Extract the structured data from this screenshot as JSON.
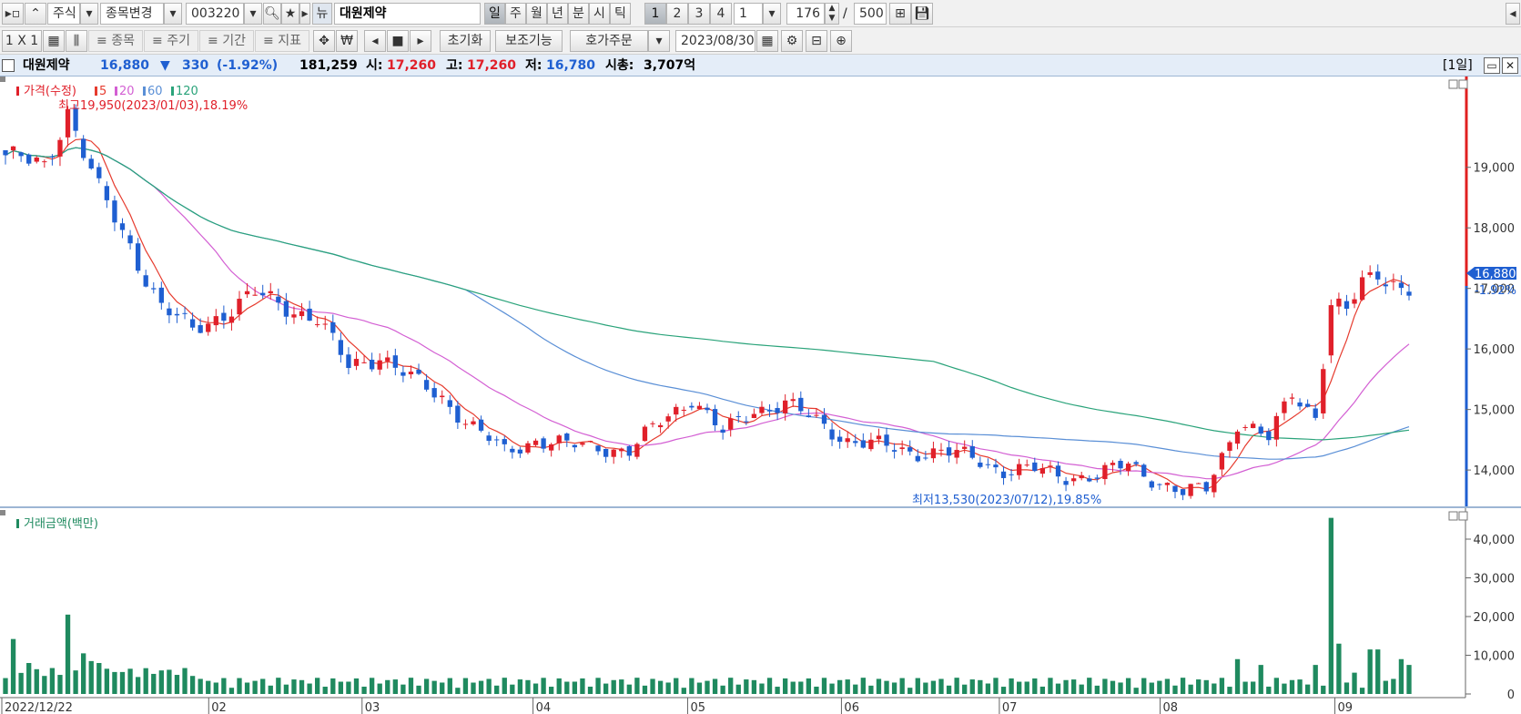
{
  "toolbar1": {
    "market": "주식",
    "change_stock": "종목변경",
    "code": "003220",
    "news_icon_label": "뉴",
    "stock_name": "대원제약",
    "periods": [
      "일",
      "주",
      "월",
      "년",
      "분",
      "시",
      "틱"
    ],
    "active_period": "일",
    "multipliers": [
      "1",
      "2",
      "3",
      "4"
    ],
    "multiplier_value": "1",
    "count": "176",
    "count_sep": "/",
    "total": "500"
  },
  "toolbar2": {
    "layout": "1 X 1",
    "stock_btn": "≡ 종목",
    "period_btn": "≡ 주기",
    "range_btn": "≡ 기간",
    "indicator_btn": "≡ 지표",
    "reset": "초기화",
    "aux": "보조기능",
    "order": "호가주문",
    "date": "2023/08/30"
  },
  "info": {
    "name": "대원제약",
    "price": "16,880",
    "change_arrow": "▼",
    "change": "330",
    "change_pct": "(-1.92%)",
    "volume": "181,259",
    "open_label": "시:",
    "open": "17,260",
    "high_label": "고:",
    "high": "17,260",
    "low_label": "저:",
    "low": "16,780",
    "mcap_label": "시총:",
    "mcap": "3,707억",
    "period_label": "[1일]"
  },
  "colors": {
    "up": "#e0202a",
    "down": "#1f5fd1",
    "ma5": "#e63b2e",
    "ma20": "#d35fd3",
    "ma60": "#5a8fd6",
    "ma120": "#2aa37a",
    "volume": "#1f8a5f"
  },
  "chart_data": {
    "type": "candlestick",
    "price_legend": {
      "main": "가격(수정)",
      "ma": [
        {
          "name": "5",
          "color": "#e63b2e"
        },
        {
          "name": "20",
          "color": "#d35fd3"
        },
        {
          "name": "60",
          "color": "#5a8fd6"
        },
        {
          "name": "120",
          "color": "#2aa37a"
        }
      ]
    },
    "annotations": {
      "high": "최고19,950(2023/01/03),18.19%",
      "low": "최저13,530(2023/07/12),19.85%"
    },
    "current_price_label": "16,880",
    "current_change_label": "-1.92%",
    "price_ylim": [
      13400,
      20500
    ],
    "price_ticks": [
      "19,000",
      "18,000",
      "17,000",
      "16,000",
      "15,000",
      "14,000"
    ],
    "price_tick_values": [
      19000,
      18000,
      17000,
      16000,
      15000,
      14000
    ],
    "volume_legend": "거래금액(백만)",
    "volume_ylim": [
      0,
      48000
    ],
    "volume_ticks": [
      "40,000",
      "30,000",
      "20,000",
      "10,000",
      "0"
    ],
    "volume_tick_values": [
      40000,
      30000,
      20000,
      10000,
      0
    ],
    "x_ticks": [
      "2022/12/22",
      "02",
      "03",
      "04",
      "05",
      "06",
      "07",
      "08",
      "09"
    ],
    "price_anchors": [
      [
        0,
        19200
      ],
      [
        5,
        19000
      ],
      [
        8,
        19950
      ],
      [
        12,
        18600
      ],
      [
        16,
        17700
      ],
      [
        20,
        16700
      ],
      [
        24,
        16300
      ],
      [
        28,
        16600
      ],
      [
        32,
        16900
      ],
      [
        36,
        16700
      ],
      [
        40,
        16500
      ],
      [
        44,
        15700
      ],
      [
        48,
        15900
      ],
      [
        52,
        15500
      ],
      [
        56,
        15200
      ],
      [
        60,
        14700
      ],
      [
        64,
        14300
      ],
      [
        68,
        14500
      ],
      [
        72,
        14400
      ],
      [
        76,
        14400
      ],
      [
        80,
        14300
      ],
      [
        84,
        14800
      ],
      [
        88,
        15200
      ],
      [
        92,
        14600
      ],
      [
        96,
        15000
      ],
      [
        100,
        15100
      ],
      [
        104,
        14800
      ],
      [
        108,
        14500
      ],
      [
        112,
        14400
      ],
      [
        116,
        14300
      ],
      [
        120,
        14300
      ],
      [
        124,
        14200
      ],
      [
        128,
        14000
      ],
      [
        132,
        14000
      ],
      [
        136,
        13900
      ],
      [
        140,
        13900
      ],
      [
        144,
        14100
      ],
      [
        148,
        13800
      ],
      [
        151,
        13600
      ],
      [
        154,
        13700
      ],
      [
        158,
        14800
      ],
      [
        162,
        14500
      ],
      [
        165,
        15300
      ],
      [
        168,
        14900
      ],
      [
        170,
        16700
      ],
      [
        172,
        16600
      ],
      [
        174,
        17100
      ],
      [
        176,
        17300
      ],
      [
        178,
        17100
      ],
      [
        180,
        16880
      ]
    ],
    "volume_spikes": [
      {
        "i": 1,
        "v": 14200
      },
      {
        "i": 3,
        "v": 8000
      },
      {
        "i": 8,
        "v": 20500
      },
      {
        "i": 10,
        "v": 10500
      },
      {
        "i": 11,
        "v": 8500
      },
      {
        "i": 12,
        "v": 8000
      },
      {
        "i": 158,
        "v": 9000
      },
      {
        "i": 161,
        "v": 7500
      },
      {
        "i": 168,
        "v": 7500
      },
      {
        "i": 170,
        "v": 45500
      },
      {
        "i": 171,
        "v": 13000
      },
      {
        "i": 173,
        "v": 5500
      },
      {
        "i": 175,
        "v": 11500
      },
      {
        "i": 176,
        "v": 11500
      },
      {
        "i": 179,
        "v": 9000
      },
      {
        "i": 180,
        "v": 7500
      }
    ],
    "bar_count": 181
  }
}
